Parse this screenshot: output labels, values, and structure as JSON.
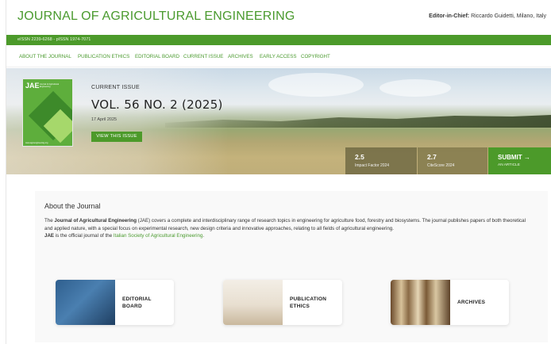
{
  "header": {
    "journal_title": "JOURNAL OF AGRICULTURAL ENGINEERING",
    "editor_label": "Editor-in-Chief:",
    "editor_name": "Riccardo Guidetti, Milano, Italy"
  },
  "issn": "eISSN 2239-6268 - pISSN 1974-7071",
  "nav": {
    "items": [
      "ABOUT THE JOURNAL",
      "PUBLICATION ETHICS",
      "EDITORIAL BOARD",
      "CURRENT ISSUE",
      "ARCHIVES",
      "EARLY ACCESS",
      "COPYRIGHT"
    ]
  },
  "hero": {
    "cover": {
      "title": "JAE",
      "subtitle": "Journal of Agricultural Engineering",
      "url": "www.agroengineering.org"
    },
    "current_label": "CURRENT ISSUE",
    "issue_title": "VOL. 56 NO. 2 (2025)",
    "issue_date": "17 April 2025",
    "view_button": "VIEW THIS ISSUE",
    "metrics": [
      {
        "value": "2.5",
        "label": "Impact Factor 2024"
      },
      {
        "value": "2.7",
        "label": "CiteScore 2024"
      }
    ],
    "submit": {
      "title": "SUBMIT →",
      "subtitle": "AN ARTICLE"
    }
  },
  "about": {
    "heading": "About the Journal",
    "p1_prefix": "The ",
    "p1_bold": "Journal of Agricultural Engineering",
    "p1_rest": " (JAE) covers a complete and interdisciplinary range of research topics in engineering for agriculture food, forestry and biosystems. The journal publishes papers of both theoretical and applied nature, with a special focus on experimental research, new design criteria and innovative approaches, relating to all fields of agricultural engineering.",
    "p2_bold": "JAE",
    "p2_text": " is the official journal of the ",
    "p2_link": "Italian Society of Agricultural Engineering",
    "p2_end": "."
  },
  "tiles": [
    {
      "line1": "EDITORIAL",
      "line2": "BOARD"
    },
    {
      "line1": "PUBLICATION",
      "line2": "ETHICS"
    },
    {
      "line1": "ARCHIVES",
      "line2": ""
    }
  ]
}
